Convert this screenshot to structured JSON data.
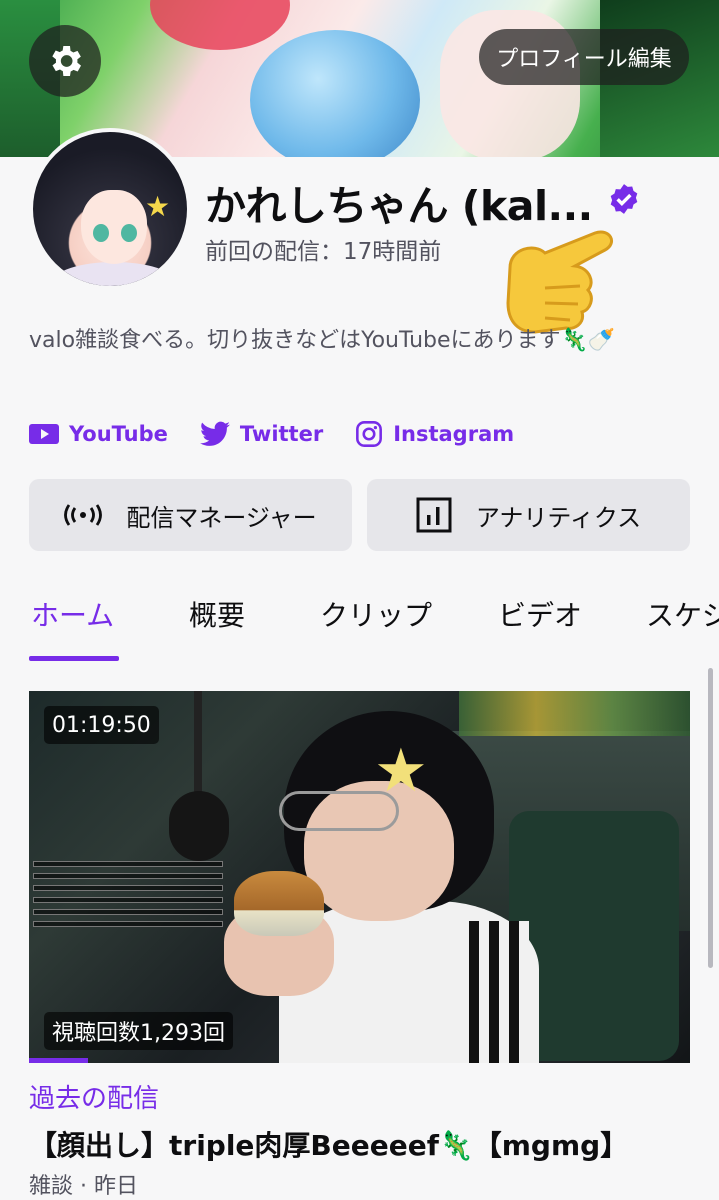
{
  "header": {
    "edit_profile_label": "プロフィール編集",
    "settings_icon": "gear-icon"
  },
  "profile": {
    "name": "かれしちゃん (kal...",
    "verified_icon": "verified-badge-icon",
    "last_stream": "前回の配信：17時間前",
    "bio": "valo雑談食べる。切り抜きなどはYouTubeにあります🦎🍼"
  },
  "socials": [
    {
      "label": "YouTube",
      "icon": "youtube-icon"
    },
    {
      "label": "Twitter",
      "icon": "twitter-icon"
    },
    {
      "label": "Instagram",
      "icon": "instagram-icon"
    }
  ],
  "actions": {
    "dashboard_label": "配信マネージャー",
    "analytics_label": "アナリティクス"
  },
  "tabs": [
    {
      "label": "ホーム",
      "active": true
    },
    {
      "label": "概要",
      "active": false
    },
    {
      "label": "クリップ",
      "active": false
    },
    {
      "label": "ビデオ",
      "active": false
    },
    {
      "label": "スケジ",
      "active": false
    }
  ],
  "video": {
    "duration": "01:19:50",
    "views": "視聴回数1,293回",
    "category": "過去の配信",
    "title": "【顔出し】triple肉厚Beeeeef🦎【mgmg】",
    "meta": "雑談 · 昨日",
    "progress": 0.09
  },
  "colors": {
    "accent": "#772ce8",
    "background": "#f7f7f8",
    "button_bg": "#e6e6ea",
    "muted_text": "#53535f"
  }
}
